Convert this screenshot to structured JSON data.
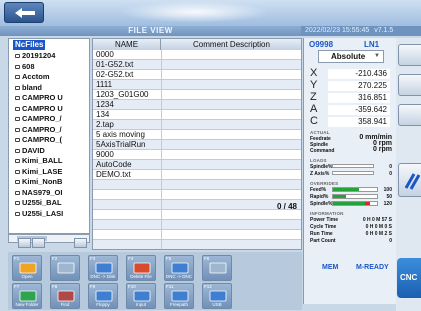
{
  "header": {
    "title": "FILE VIEW",
    "datetime": "2022/02/23 15:55:45",
    "version": "v7.1.5"
  },
  "tree": {
    "root": "NcFiles",
    "items": [
      "20191204",
      "608",
      "Acctom",
      "bland",
      "CAMPRO U",
      "CAMPRO U",
      "CAMPRO_/",
      "CAMPRO_/",
      "CAMPRO_(",
      "DAVID",
      "Kimi_BALL",
      "Kimi_LASE",
      "Kimi_NonB",
      "NAS979_OI",
      "U255i_BAL",
      "U255i_LASI"
    ]
  },
  "files": {
    "col_name": "NAME",
    "col_comment": "Comment Description",
    "rows": [
      "0000",
      "01-G52.txt",
      "02-G52.txt",
      "1111",
      "1203_G01G00",
      "1234",
      "134",
      "2.tap",
      "5 axis moving",
      "5AxisTrialRun",
      "9000",
      "AutoCode",
      "DEMO.txt"
    ],
    "count": "0 / 48"
  },
  "machine": {
    "program": "O9998",
    "tool": "LN1",
    "mode": "Absolute",
    "axes": [
      {
        "label": "X",
        "value": "-210.436"
      },
      {
        "label": "Y",
        "value": "270.225"
      },
      {
        "label": "Z",
        "value": "316.851"
      },
      {
        "label": "A",
        "value": "-359.642"
      },
      {
        "label": "C",
        "value": "358.941"
      }
    ],
    "actual_title": "ACTUAL",
    "feedrate_label": "Feedrate",
    "feedrate_value": "0 mm/min",
    "spindle_label": "Spindle",
    "spindle_value": "0 rpm",
    "command_label": "Command",
    "command_value": "0 rpm",
    "load_title": "LOADS",
    "spindle_load_label": "Spindle%",
    "spindle_load_value": "0",
    "zaxis_load_label": "Z Axis%",
    "zaxis_load_value": "0",
    "overrides_title": "OVERRIDES",
    "feed_ov_label": "Feed%",
    "feed_ov_value": "100",
    "rapid_ov_label": "Rapid%",
    "rapid_ov_value": "50",
    "spindle_ov_label": "Spindle%",
    "spindle_ov_value": "120",
    "feed_ov_level": 0.6,
    "rapid_ov_level": 0.3,
    "spindle_ov_level": 0.72,
    "info_title": "INFORMATION",
    "power_label": "Power Time",
    "power_value": "0 H 0 M 57 S",
    "cycle_label": "Cycle Time",
    "cycle_value": "0 H 0 M 0 S",
    "run_label": "Run Time",
    "run_value": "0 H 0 M 2 S",
    "part_label": "Part Count",
    "part_value": "0",
    "mem": "MEM",
    "ready": "M-READY"
  },
  "softkeys": [
    {
      "fn": "F1",
      "label": "Open"
    },
    {
      "fn": "F2",
      "label": ""
    },
    {
      "fn": "F3",
      "label": "DNC -> Disk"
    },
    {
      "fn": "F4",
      "label": "Delete File"
    },
    {
      "fn": "F5",
      "label": "DNC -> DNC"
    },
    {
      "fn": "F6",
      "label": ""
    },
    {
      "fn": "F7",
      "label": "New Folder"
    },
    {
      "fn": "F8",
      "label": "Find"
    },
    {
      "fn": "F9",
      "label": "Floppy"
    },
    {
      "fn": "F10",
      "label": "Input"
    },
    {
      "fn": "F11",
      "label": "Freepath"
    },
    {
      "fn": "F12",
      "label": "USB"
    }
  ],
  "cnc_label": "CNC",
  "colors": {
    "accent": "#1a56c8",
    "ov_green": "#23a33a",
    "ov_red": "#d92b2b"
  }
}
